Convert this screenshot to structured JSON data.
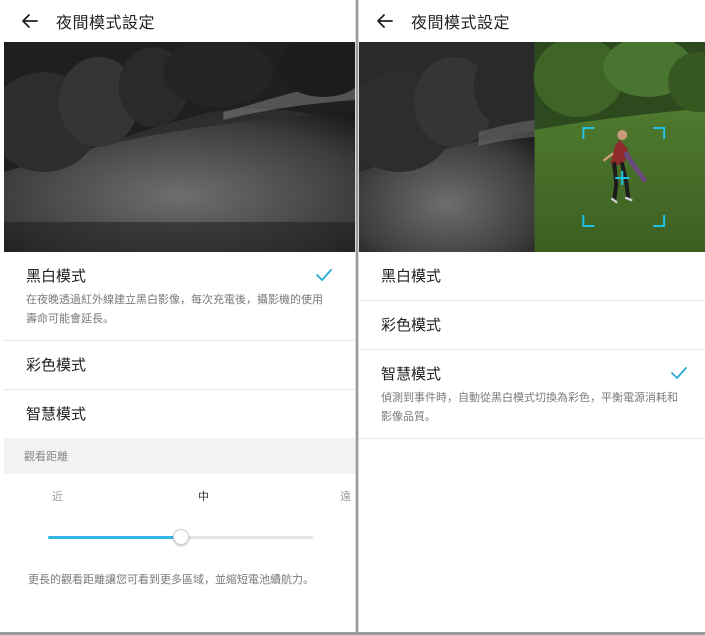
{
  "colors": {
    "accent": "#33b5e5",
    "check": "#2aa8d8",
    "text_primary": "#222222",
    "text_secondary": "#7a7a7a",
    "section_bg": "#f2f2f2"
  },
  "left_screen": {
    "header": {
      "back_icon": "arrow-left-icon",
      "title": "夜間模式設定"
    },
    "preview": {
      "mode": "black-and-white night image"
    },
    "options": [
      {
        "label": "黑白模式",
        "selected": true,
        "description": "在夜晚透過紅外線建立黑白影像，每次充電後，攝影機的使用壽命可能會延長。"
      },
      {
        "label": "彩色模式",
        "selected": false
      },
      {
        "label": "智慧模式",
        "selected": false
      }
    ],
    "viewing_distance": {
      "section_title": "觀看距離",
      "label_near": "近",
      "label_mid": "中",
      "label_far": "遠",
      "value_fraction": 0.5,
      "footnote": "更長的觀看距離讓您可看到更多區域，並縮短電池續航力。"
    }
  },
  "right_screen": {
    "header": {
      "back_icon": "arrow-left-icon",
      "title": "夜間模式設定"
    },
    "preview": {
      "mode": "split black-and-white / color with detection box"
    },
    "options": [
      {
        "label": "黑白模式",
        "selected": false
      },
      {
        "label": "彩色模式",
        "selected": false
      },
      {
        "label": "智慧模式",
        "selected": true,
        "description": "偵測到事件時，自動從黑白模式切換為彩色，平衡電源消耗和影像品質。"
      }
    ]
  }
}
